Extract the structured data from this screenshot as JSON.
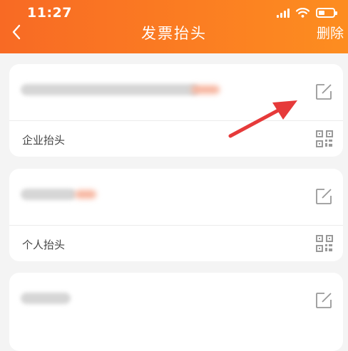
{
  "status_bar": {
    "time": "11:27",
    "battery_level": 0.4
  },
  "header": {
    "title": "发票抬头",
    "delete_label": "删除",
    "back_icon": "chevron-left-icon"
  },
  "invoices": [
    {
      "type_label": "企业抬头"
    },
    {
      "type_label": "个人抬头"
    },
    {
      "type_label": ""
    }
  ],
  "colors": {
    "header_start": "#f86a24",
    "header_end": "#fd8d20",
    "arrow": "#e63a3a",
    "icon_gray": "#999999"
  }
}
